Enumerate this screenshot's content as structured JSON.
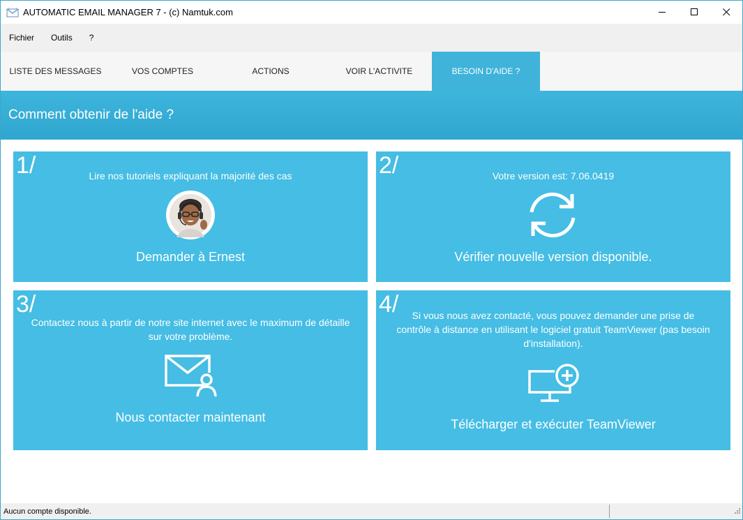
{
  "window": {
    "title": "AUTOMATIC EMAIL MANAGER 7 - (c) Namtuk.com"
  },
  "menu": {
    "items": [
      {
        "label": "Fichier"
      },
      {
        "label": "Outils"
      },
      {
        "label": "?"
      }
    ]
  },
  "tabs": [
    {
      "label": "LISTE DES MESSAGES",
      "active": false
    },
    {
      "label": "VOS COMPTES",
      "active": false
    },
    {
      "label": "ACTIONS",
      "active": false
    },
    {
      "label": "VOIR L'ACTIVITE",
      "active": false
    },
    {
      "label": "BESOIN D'AIDE ?",
      "active": true
    }
  ],
  "header": {
    "title": "Comment obtenir de l'aide ?"
  },
  "panels": [
    {
      "number": "1/",
      "description": "Lire nos tutoriels expliquant la majorité des cas",
      "action": "Demander à Ernest",
      "icon": "ernest-avatar"
    },
    {
      "number": "2/",
      "description": "Votre version est: 7.06.0419",
      "action": "Vérifier nouvelle version disponible.",
      "icon": "refresh-icon"
    },
    {
      "number": "3/",
      "description": "Contactez nous à partir de notre site internet avec le maximum de détaille sur votre problème.",
      "action": "Nous contacter maintenant",
      "icon": "mail-contact-icon"
    },
    {
      "number": "4/",
      "description": "Si vous nous avez contacté, vous pouvez demander une prise de contrôle à distance en utilisant le logiciel gratuit TeamViewer (pas besoin d'installation).",
      "action": "Télécharger et exécuter TeamViewer",
      "icon": "monitor-add-icon"
    }
  ],
  "status": {
    "text": "Aucun compte disponible."
  },
  "colors": {
    "accent": "#3fb3d9",
    "panel": "#45bde4"
  }
}
